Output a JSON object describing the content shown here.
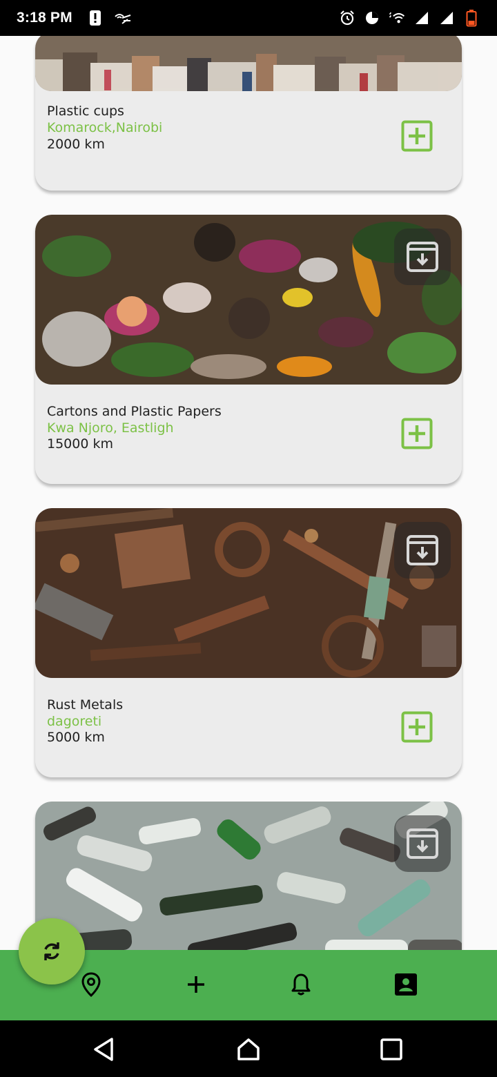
{
  "status_bar": {
    "time": "3:18 PM",
    "icons": [
      "alert-icon",
      "antenna-icon",
      "alarm-icon",
      "data-saver-icon",
      "wifi-icon",
      "signal-icon",
      "signal-icon",
      "battery-low-icon"
    ]
  },
  "cards": [
    {
      "title": "Plastic cups",
      "location": "Komarock,Nairobi",
      "distance": "2000 km",
      "image": "mixed-paper-waste"
    },
    {
      "title": "Cartons and Plastic Papers",
      "location": "Kwa Njoro, Eastligh",
      "distance": "15000 km",
      "image": "organic-waste"
    },
    {
      "title": "Rust Metals",
      "location": "dagoreti",
      "distance": "5000 km",
      "image": "scrap-metal"
    },
    {
      "title": "",
      "location": "",
      "distance": "",
      "image": "glass-bottles"
    }
  ],
  "bottom_nav": {
    "items": [
      "location-icon",
      "add-icon",
      "bell-icon",
      "account-box-icon"
    ]
  },
  "fab": {
    "icon": "refresh-icon"
  },
  "colors": {
    "accent_green": "#7cc146",
    "nav_green": "#4caf50",
    "fab_green": "#8bc34a",
    "card_bg": "#ececec"
  }
}
